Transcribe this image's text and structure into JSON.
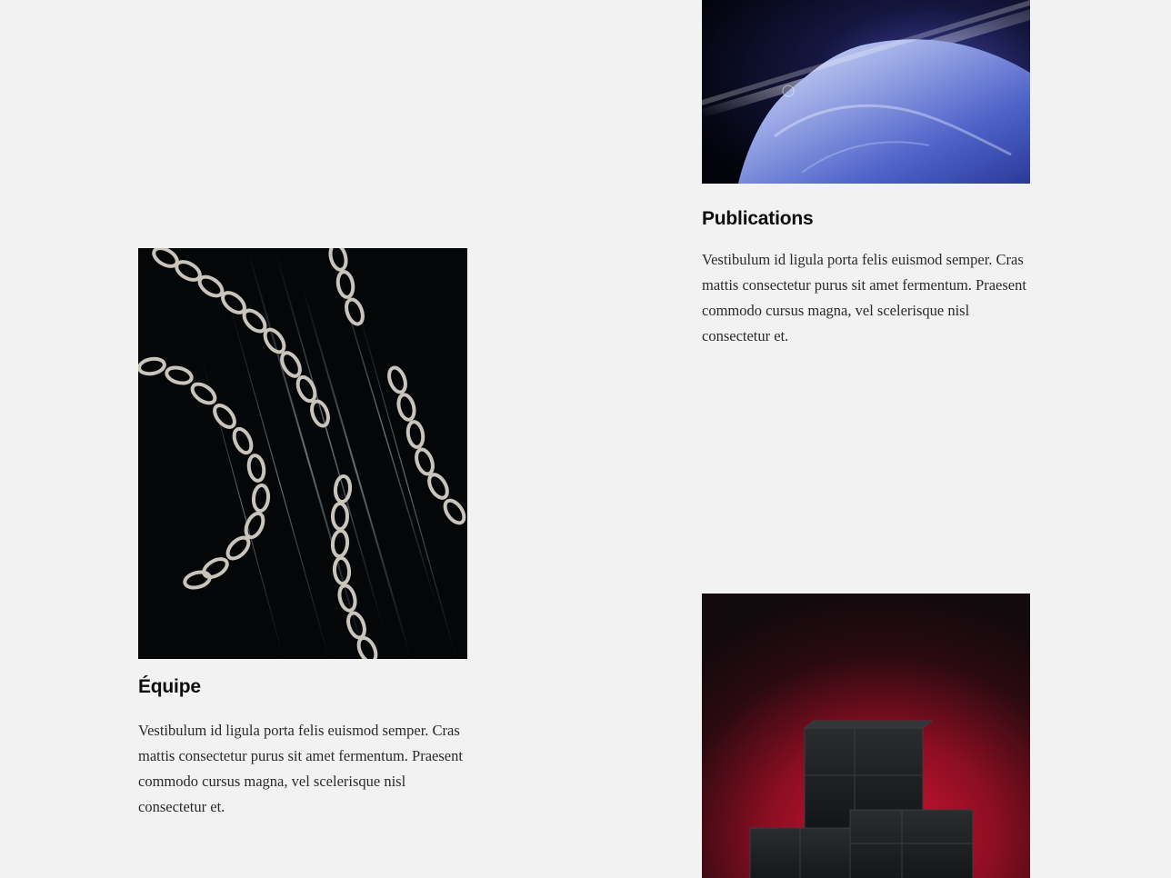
{
  "cards": [
    {
      "title": "Publications",
      "body": "Vestibulum id ligula porta felis euismod semper. Cras mattis consectetur purus sit amet fermentum. Praesent commodo cursus magna, vel scelerisque nisl consectetur et.",
      "image": "ice-rock-image"
    },
    {
      "title": "Équipe",
      "body": "Vestibulum id ligula porta felis euismod semper. Cras mattis consectetur purus sit amet fermentum. Praesent commodo cursus magna, vel scelerisque nisl consectetur et.",
      "image": "chains-image"
    },
    {
      "title": "",
      "body": "",
      "image": "cubes-image"
    }
  ],
  "colors": {
    "background": "#f2f2f2",
    "title": "#0d0d0d",
    "body_text": "#2a2a2a",
    "accent_red": "#b0142a"
  }
}
